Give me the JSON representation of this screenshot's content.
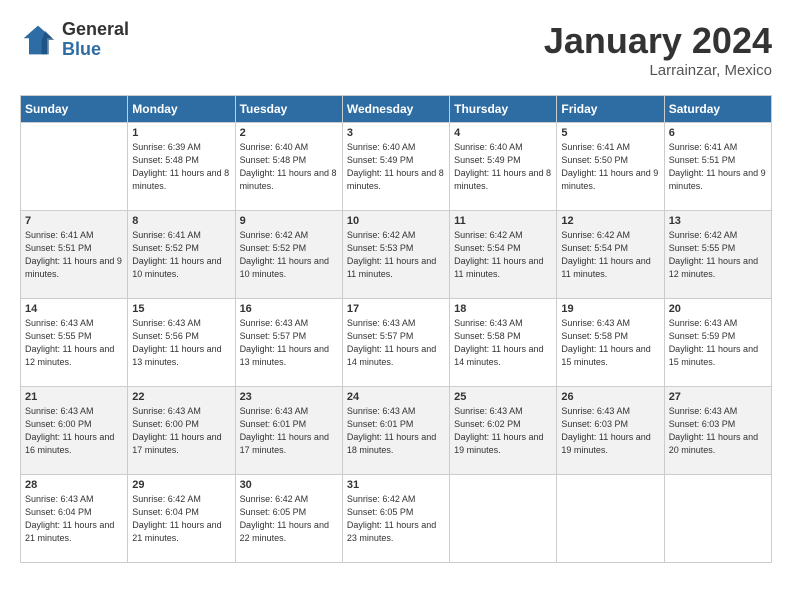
{
  "header": {
    "logo_general": "General",
    "logo_blue": "Blue",
    "month_title": "January 2024",
    "subtitle": "Larrainzar, Mexico"
  },
  "days_of_week": [
    "Sunday",
    "Monday",
    "Tuesday",
    "Wednesday",
    "Thursday",
    "Friday",
    "Saturday"
  ],
  "weeks": [
    [
      {
        "day": "",
        "sunrise": "",
        "sunset": "",
        "daylight": ""
      },
      {
        "day": "1",
        "sunrise": "Sunrise: 6:39 AM",
        "sunset": "Sunset: 5:48 PM",
        "daylight": "Daylight: 11 hours and 8 minutes."
      },
      {
        "day": "2",
        "sunrise": "Sunrise: 6:40 AM",
        "sunset": "Sunset: 5:48 PM",
        "daylight": "Daylight: 11 hours and 8 minutes."
      },
      {
        "day": "3",
        "sunrise": "Sunrise: 6:40 AM",
        "sunset": "Sunset: 5:49 PM",
        "daylight": "Daylight: 11 hours and 8 minutes."
      },
      {
        "day": "4",
        "sunrise": "Sunrise: 6:40 AM",
        "sunset": "Sunset: 5:49 PM",
        "daylight": "Daylight: 11 hours and 8 minutes."
      },
      {
        "day": "5",
        "sunrise": "Sunrise: 6:41 AM",
        "sunset": "Sunset: 5:50 PM",
        "daylight": "Daylight: 11 hours and 9 minutes."
      },
      {
        "day": "6",
        "sunrise": "Sunrise: 6:41 AM",
        "sunset": "Sunset: 5:51 PM",
        "daylight": "Daylight: 11 hours and 9 minutes."
      }
    ],
    [
      {
        "day": "7",
        "sunrise": "Sunrise: 6:41 AM",
        "sunset": "Sunset: 5:51 PM",
        "daylight": "Daylight: 11 hours and 9 minutes."
      },
      {
        "day": "8",
        "sunrise": "Sunrise: 6:41 AM",
        "sunset": "Sunset: 5:52 PM",
        "daylight": "Daylight: 11 hours and 10 minutes."
      },
      {
        "day": "9",
        "sunrise": "Sunrise: 6:42 AM",
        "sunset": "Sunset: 5:52 PM",
        "daylight": "Daylight: 11 hours and 10 minutes."
      },
      {
        "day": "10",
        "sunrise": "Sunrise: 6:42 AM",
        "sunset": "Sunset: 5:53 PM",
        "daylight": "Daylight: 11 hours and 11 minutes."
      },
      {
        "day": "11",
        "sunrise": "Sunrise: 6:42 AM",
        "sunset": "Sunset: 5:54 PM",
        "daylight": "Daylight: 11 hours and 11 minutes."
      },
      {
        "day": "12",
        "sunrise": "Sunrise: 6:42 AM",
        "sunset": "Sunset: 5:54 PM",
        "daylight": "Daylight: 11 hours and 11 minutes."
      },
      {
        "day": "13",
        "sunrise": "Sunrise: 6:42 AM",
        "sunset": "Sunset: 5:55 PM",
        "daylight": "Daylight: 11 hours and 12 minutes."
      }
    ],
    [
      {
        "day": "14",
        "sunrise": "Sunrise: 6:43 AM",
        "sunset": "Sunset: 5:55 PM",
        "daylight": "Daylight: 11 hours and 12 minutes."
      },
      {
        "day": "15",
        "sunrise": "Sunrise: 6:43 AM",
        "sunset": "Sunset: 5:56 PM",
        "daylight": "Daylight: 11 hours and 13 minutes."
      },
      {
        "day": "16",
        "sunrise": "Sunrise: 6:43 AM",
        "sunset": "Sunset: 5:57 PM",
        "daylight": "Daylight: 11 hours and 13 minutes."
      },
      {
        "day": "17",
        "sunrise": "Sunrise: 6:43 AM",
        "sunset": "Sunset: 5:57 PM",
        "daylight": "Daylight: 11 hours and 14 minutes."
      },
      {
        "day": "18",
        "sunrise": "Sunrise: 6:43 AM",
        "sunset": "Sunset: 5:58 PM",
        "daylight": "Daylight: 11 hours and 14 minutes."
      },
      {
        "day": "19",
        "sunrise": "Sunrise: 6:43 AM",
        "sunset": "Sunset: 5:58 PM",
        "daylight": "Daylight: 11 hours and 15 minutes."
      },
      {
        "day": "20",
        "sunrise": "Sunrise: 6:43 AM",
        "sunset": "Sunset: 5:59 PM",
        "daylight": "Daylight: 11 hours and 15 minutes."
      }
    ],
    [
      {
        "day": "21",
        "sunrise": "Sunrise: 6:43 AM",
        "sunset": "Sunset: 6:00 PM",
        "daylight": "Daylight: 11 hours and 16 minutes."
      },
      {
        "day": "22",
        "sunrise": "Sunrise: 6:43 AM",
        "sunset": "Sunset: 6:00 PM",
        "daylight": "Daylight: 11 hours and 17 minutes."
      },
      {
        "day": "23",
        "sunrise": "Sunrise: 6:43 AM",
        "sunset": "Sunset: 6:01 PM",
        "daylight": "Daylight: 11 hours and 17 minutes."
      },
      {
        "day": "24",
        "sunrise": "Sunrise: 6:43 AM",
        "sunset": "Sunset: 6:01 PM",
        "daylight": "Daylight: 11 hours and 18 minutes."
      },
      {
        "day": "25",
        "sunrise": "Sunrise: 6:43 AM",
        "sunset": "Sunset: 6:02 PM",
        "daylight": "Daylight: 11 hours and 19 minutes."
      },
      {
        "day": "26",
        "sunrise": "Sunrise: 6:43 AM",
        "sunset": "Sunset: 6:03 PM",
        "daylight": "Daylight: 11 hours and 19 minutes."
      },
      {
        "day": "27",
        "sunrise": "Sunrise: 6:43 AM",
        "sunset": "Sunset: 6:03 PM",
        "daylight": "Daylight: 11 hours and 20 minutes."
      }
    ],
    [
      {
        "day": "28",
        "sunrise": "Sunrise: 6:43 AM",
        "sunset": "Sunset: 6:04 PM",
        "daylight": "Daylight: 11 hours and 21 minutes."
      },
      {
        "day": "29",
        "sunrise": "Sunrise: 6:42 AM",
        "sunset": "Sunset: 6:04 PM",
        "daylight": "Daylight: 11 hours and 21 minutes."
      },
      {
        "day": "30",
        "sunrise": "Sunrise: 6:42 AM",
        "sunset": "Sunset: 6:05 PM",
        "daylight": "Daylight: 11 hours and 22 minutes."
      },
      {
        "day": "31",
        "sunrise": "Sunrise: 6:42 AM",
        "sunset": "Sunset: 6:05 PM",
        "daylight": "Daylight: 11 hours and 23 minutes."
      },
      {
        "day": "",
        "sunrise": "",
        "sunset": "",
        "daylight": ""
      },
      {
        "day": "",
        "sunrise": "",
        "sunset": "",
        "daylight": ""
      },
      {
        "day": "",
        "sunrise": "",
        "sunset": "",
        "daylight": ""
      }
    ]
  ]
}
